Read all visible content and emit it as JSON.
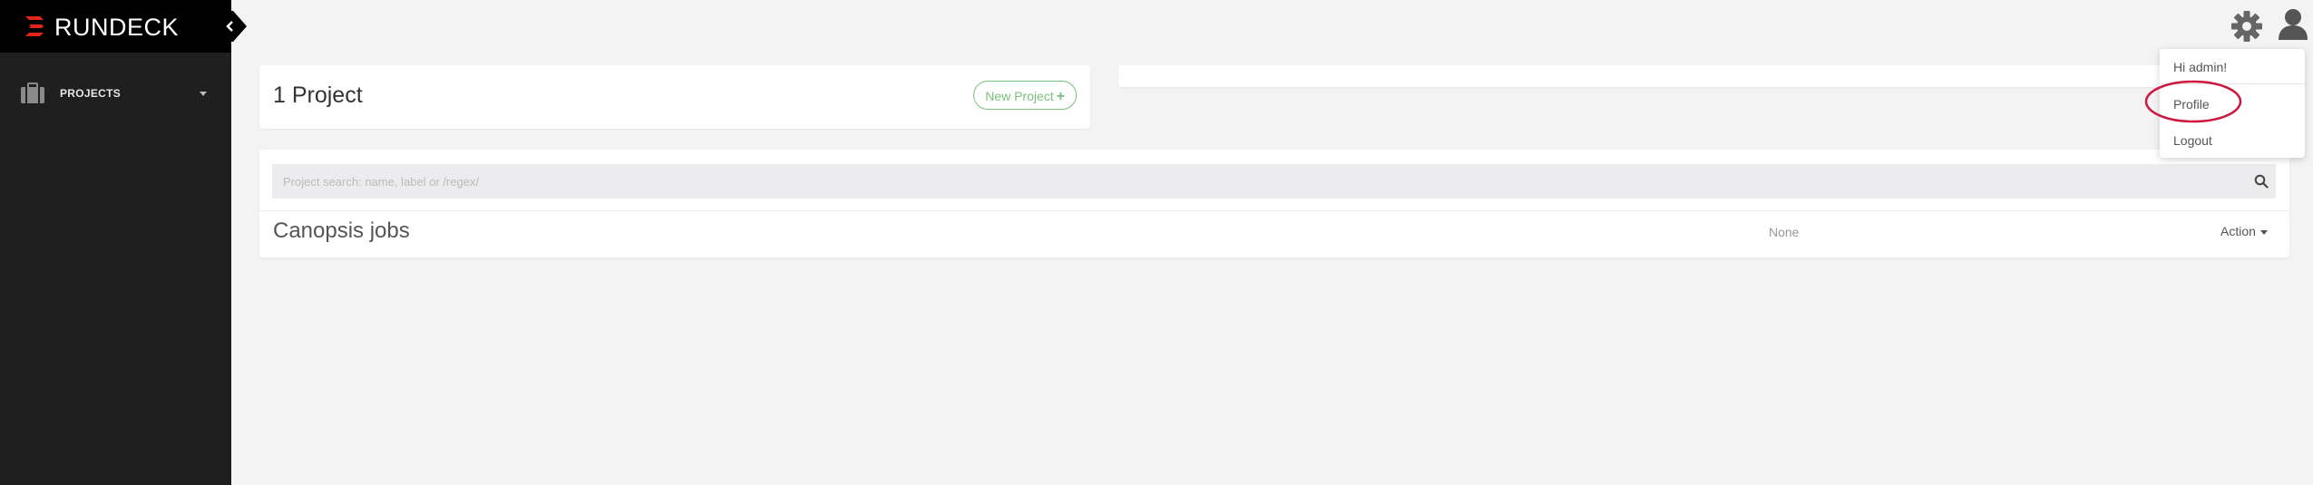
{
  "brand": {
    "name": "RUNDECK",
    "logo_color": "#e1251b"
  },
  "sidebar": {
    "projects_label": "PROJECTS"
  },
  "header": {
    "icons": [
      "gear-icon",
      "user-icon"
    ]
  },
  "projects_summary": {
    "title": "1 Project",
    "new_button": "New Project",
    "new_icon": "+"
  },
  "search": {
    "placeholder": "Project search: name, label or /regex/",
    "value": ""
  },
  "project_list": [
    {
      "name": "Canopsis jobs",
      "description": "None",
      "action_label": "Action"
    }
  ],
  "user_menu": {
    "greeting": "Hi admin!",
    "items": [
      "Profile",
      "Logout"
    ],
    "highlight_color": "#d0163f"
  },
  "colors": {
    "sidebar_bg": "#1f1f1f",
    "brand_bg": "#000000",
    "page_bg": "#f3f3f3",
    "new_project_accent": "#79c07a"
  }
}
